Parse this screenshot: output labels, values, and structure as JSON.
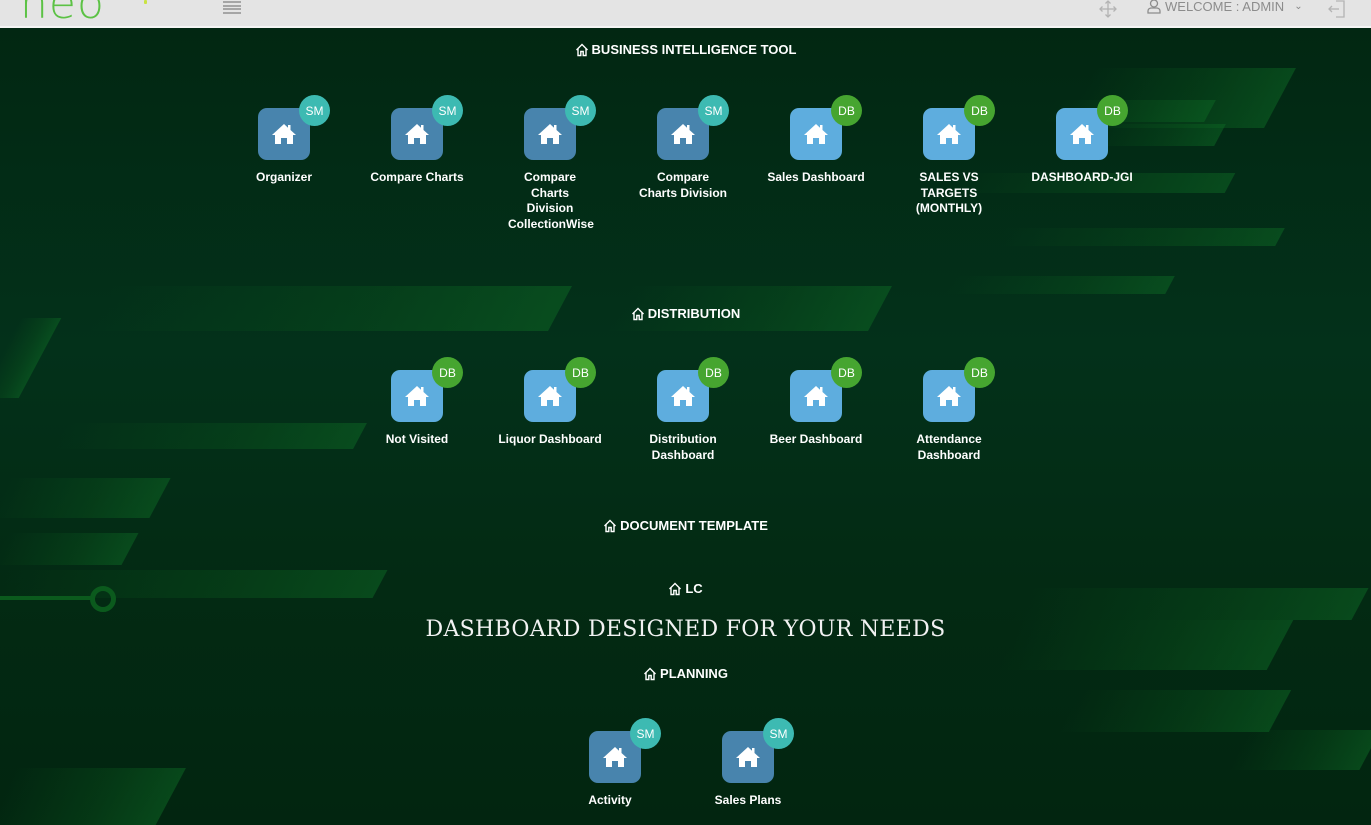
{
  "header": {
    "logo_text": "neo",
    "welcome_label": "WELCOME : ADMIN",
    "icons": [
      "menu-icon",
      "move-icon",
      "user-icon",
      "chevron-down-icon",
      "logout-icon"
    ]
  },
  "colors": {
    "logo_green": "#5cc245",
    "sm_tile": "#4884ad",
    "db_tile": "#5eadde",
    "sm_badge": "#3dbab2",
    "db_badge": "#46a530",
    "background": "#032a12"
  },
  "sections": [
    {
      "title": "BUSINESS INTELLIGENCE TOOL",
      "items": [
        {
          "label": "Organizer",
          "badge": "SM"
        },
        {
          "label": "Compare Charts",
          "badge": "SM"
        },
        {
          "label": "Compare Charts Division CollectionWise",
          "badge": "SM"
        },
        {
          "label": "Compare Charts Division",
          "badge": "SM"
        },
        {
          "label": "Sales Dashboard",
          "badge": "DB"
        },
        {
          "label": "SALES VS TARGETS (MONTHLY)",
          "badge": "DB"
        },
        {
          "label": "DASHBOARD-JGI",
          "badge": "DB"
        }
      ]
    },
    {
      "title": "DISTRIBUTION",
      "items": [
        {
          "label": "Not Visited",
          "badge": "DB"
        },
        {
          "label": "Liquor Dashboard",
          "badge": "DB"
        },
        {
          "label": "Distribution Dashboard",
          "badge": "DB"
        },
        {
          "label": "Beer Dashboard",
          "badge": "DB"
        },
        {
          "label": "Attendance Dashboard",
          "badge": "DB"
        }
      ]
    },
    {
      "title": "DOCUMENT TEMPLATE",
      "items": []
    },
    {
      "title": "LC",
      "items": []
    },
    {
      "title": "PLANNING",
      "items": [
        {
          "label": "Activity",
          "badge": "SM"
        },
        {
          "label": "Sales Plans",
          "badge": "SM"
        }
      ]
    }
  ],
  "tagline": "DASHBOARD DESIGNED FOR YOUR NEEDS"
}
